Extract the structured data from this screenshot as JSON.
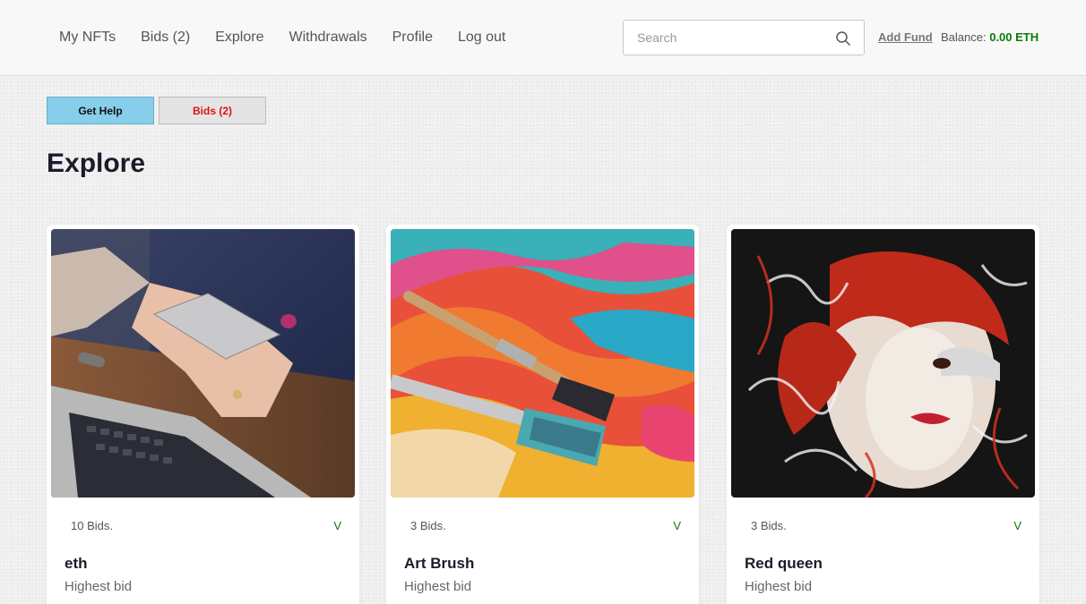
{
  "nav": {
    "links": [
      "My NFTs",
      "Bids (2)",
      "Explore",
      "Withdrawals",
      "Profile",
      "Log out"
    ],
    "search_placeholder": "Search",
    "search_icon": "search-icon",
    "add_fund": "Add Fund",
    "balance_label": "Balance:",
    "balance_value": "0.00 ETH",
    "balance_color": "#0a7a0a"
  },
  "actions": {
    "get_help": "Get Help",
    "bids": "Bids (2)",
    "get_help_color": "#87ceeb",
    "bids_text_color": "#e01010"
  },
  "page": {
    "title": "Explore"
  },
  "cards": [
    {
      "bids": "10 Bids.",
      "badge": "V",
      "name": "eth",
      "highest_bid_label": "Highest bid",
      "image": "hand-holding-phone-over-laptop"
    },
    {
      "bids": "3 Bids.",
      "badge": "V",
      "name": "Art Brush",
      "highest_bid_label": "Highest bid",
      "image": "paint-brushes-on-palette"
    },
    {
      "bids": "3 Bids.",
      "badge": "V",
      "name": "Red queen",
      "highest_bid_label": "Highest bid",
      "image": "abstract-red-portrait"
    }
  ]
}
